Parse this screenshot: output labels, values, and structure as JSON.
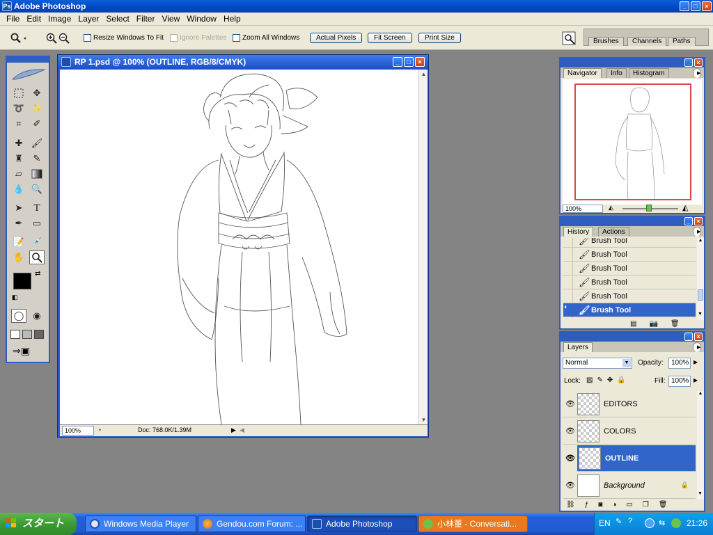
{
  "app": {
    "title": "Adobe Photoshop",
    "icon": "photoshop-icon"
  },
  "menu": [
    "File",
    "Edit",
    "Image",
    "Layer",
    "Select",
    "Filter",
    "View",
    "Window",
    "Help"
  ],
  "options": {
    "tool_icon": "zoom-tool-icon",
    "resize_windows": "Resize Windows To Fit",
    "ignore_palettes": "Ignore Palettes",
    "zoom_all": "Zoom All Windows",
    "actual_pixels": "Actual Pixels",
    "fit_screen": "Fit Screen",
    "print_size": "Print Size",
    "palette_tabs": [
      "Brushes",
      "Channels",
      "Paths"
    ]
  },
  "document": {
    "title": "RP 1.psd @ 100% (OUTLINE, RGB/8/CMYK)",
    "zoom": "100%",
    "doc_info": "Doc: 768.0K/1.39M"
  },
  "navigator": {
    "tabs": [
      "Navigator",
      "Info",
      "Histogram"
    ],
    "zoom": "100%"
  },
  "history": {
    "tabs": [
      "History",
      "Actions"
    ],
    "items": [
      "Brush Tool",
      "Brush Tool",
      "Brush Tool",
      "Brush Tool",
      "Brush Tool",
      "Brush Tool"
    ],
    "selected_index": 5
  },
  "layers": {
    "tab": "Layers",
    "blend_mode": "Normal",
    "opacity_label": "Opacity:",
    "opacity": "100%",
    "lock_label": "Lock:",
    "fill_label": "Fill:",
    "fill": "100%",
    "items": [
      "EDITORS",
      "COLORS",
      "OUTLINE",
      "Background"
    ],
    "selected_index": 2
  },
  "taskbar": {
    "start": "スタート",
    "tasks": [
      "Windows Media Player",
      "Gendou.com Forum: ...",
      "Adobe Photoshop",
      "小林董 - Conversati..."
    ],
    "lang": "EN",
    "clock": "21:26"
  },
  "colors": {
    "title_blue": "#0a4fd0",
    "selection": "#3165c9",
    "panel_bg": "#ece9d8",
    "taskbar": "#245ed8",
    "start_green": "#3d9a34"
  }
}
